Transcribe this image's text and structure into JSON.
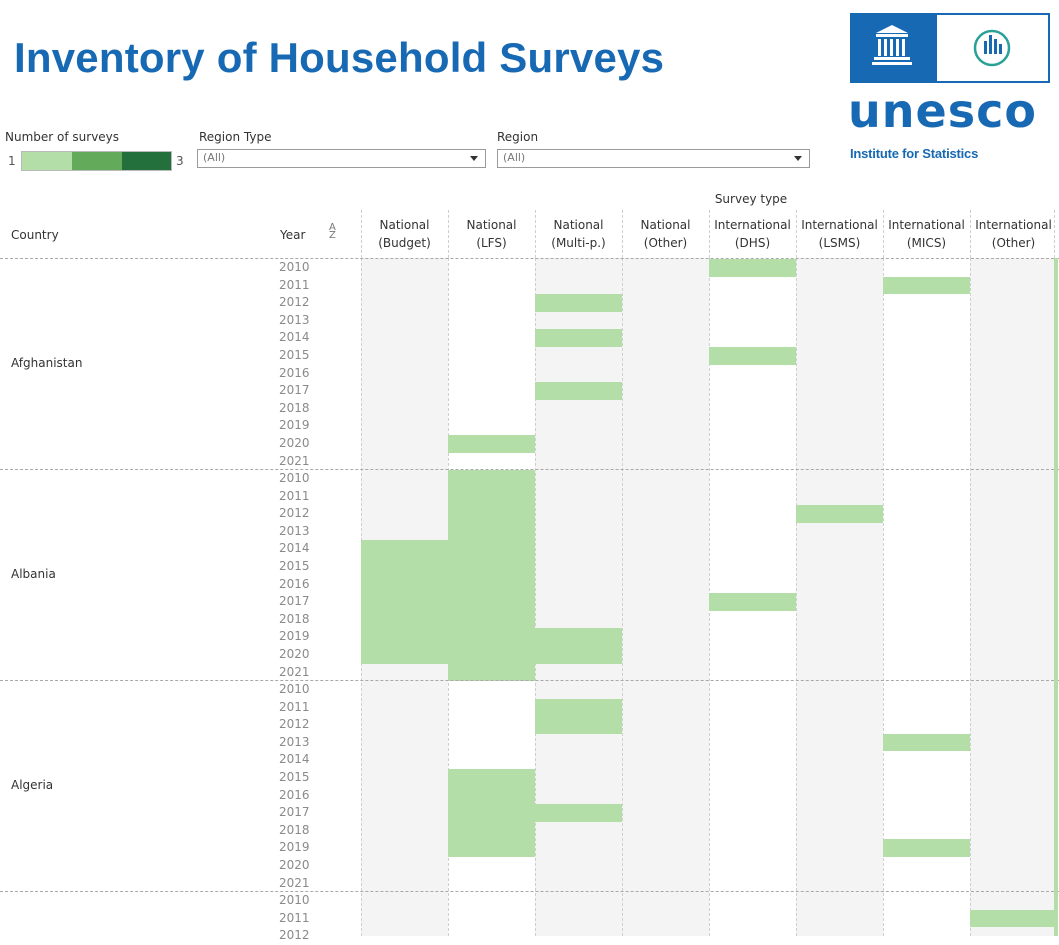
{
  "title": "Inventory of Household Surveys",
  "logo": {
    "word": "unesco",
    "subtitle": "Institute for Statistics",
    "icon_left": "unesco-temple-icon",
    "icon_right": "uis-bars-icon"
  },
  "legend": {
    "label": "Number of surveys",
    "min": "1",
    "max": "3",
    "colors": [
      "#b3dea7",
      "#63aa5a",
      "#23703c"
    ]
  },
  "filters": [
    {
      "label": "Region Type",
      "value": "(All)"
    },
    {
      "label": "Region",
      "value": "(All)"
    }
  ],
  "table": {
    "group_header": "Survey type",
    "country_header": "Country",
    "year_header": "Year",
    "sort_icon": "sort-icon",
    "columns": [
      {
        "line1": "National",
        "line2": "(Budget)"
      },
      {
        "line1": "National",
        "line2": "(LFS)"
      },
      {
        "line1": "National",
        "line2": "(Multi-p.)"
      },
      {
        "line1": "National",
        "line2": "(Other)"
      },
      {
        "line1": "International",
        "line2": "(DHS)"
      },
      {
        "line1": "International",
        "line2": "(LSMS)"
      },
      {
        "line1": "International",
        "line2": "(MICS)"
      },
      {
        "line1": "International",
        "line2": "(Other)"
      }
    ],
    "years": [
      "2010",
      "2011",
      "2012",
      "2013",
      "2014",
      "2015",
      "2016",
      "2017",
      "2018",
      "2019",
      "2020",
      "2021"
    ],
    "cell_color": "#b3dea7",
    "countries": [
      {
        "name": "Afghanistan",
        "surveys": [
          [],
          [
            2020
          ],
          [
            2012,
            2014,
            2017
          ],
          [],
          [
            2010,
            2015
          ],
          [],
          [
            2011
          ],
          []
        ]
      },
      {
        "name": "Albania",
        "surveys": [
          [
            2014,
            2015,
            2016,
            2017,
            2018,
            2019,
            2020
          ],
          [
            2010,
            2011,
            2012,
            2013,
            2014,
            2015,
            2016,
            2017,
            2018,
            2019,
            2020,
            2021
          ],
          [
            2019,
            2020
          ],
          [],
          [
            2017
          ],
          [
            2012
          ],
          [],
          []
        ]
      },
      {
        "name": "Algeria",
        "surveys": [
          [],
          [
            2015,
            2016,
            2017,
            2018,
            2019
          ],
          [
            2011,
            2012,
            2017
          ],
          [],
          [],
          [],
          [
            2013,
            2019
          ],
          []
        ]
      },
      {
        "name": "",
        "surveys": [
          [],
          [],
          [],
          [],
          [],
          [],
          [],
          [
            2011
          ]
        ]
      }
    ]
  }
}
